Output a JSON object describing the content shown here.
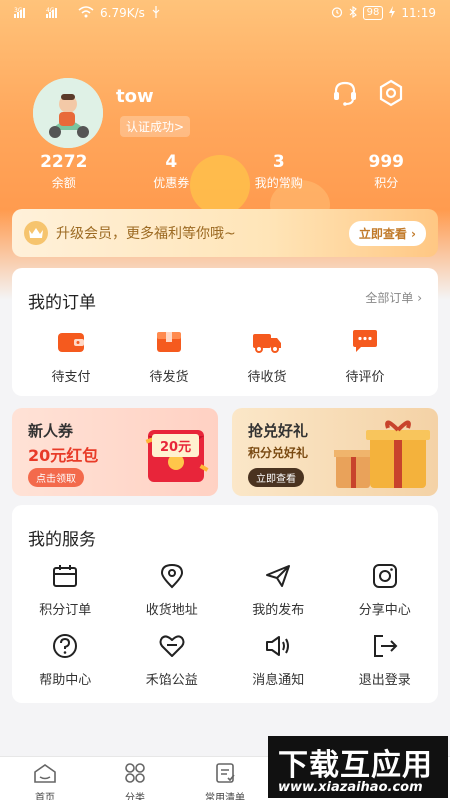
{
  "status_bar": {
    "speed": "6.79K/s",
    "battery": "98",
    "time": "11:19"
  },
  "profile": {
    "username": "tow",
    "verify_label": "认证成功>"
  },
  "stats": [
    {
      "value": "2272",
      "label": "余额"
    },
    {
      "value": "4",
      "label": "优惠券"
    },
    {
      "value": "3",
      "label": "我的常购"
    },
    {
      "value": "999",
      "label": "积分"
    }
  ],
  "vip_banner": {
    "text": "升级会员，更多福利等你哦~",
    "button": "立即查看 ›"
  },
  "orders": {
    "title": "我的订单",
    "all_link": "全部订单 ›",
    "items": [
      {
        "label": "待支付",
        "icon": "wallet-icon"
      },
      {
        "label": "待发货",
        "icon": "box-icon"
      },
      {
        "label": "待收货",
        "icon": "truck-icon"
      },
      {
        "label": "待评价",
        "icon": "comment-icon"
      }
    ]
  },
  "promos": [
    {
      "title": "新人券",
      "subtitle": "20元红包",
      "button": "点击领取",
      "badge": "20元"
    },
    {
      "title": "抢兑好礼",
      "subtitle": "积分兑好礼",
      "button": "立即查看"
    }
  ],
  "services": {
    "title": "我的服务",
    "items": [
      {
        "label": "积分订单",
        "icon": "calendar-icon"
      },
      {
        "label": "收货地址",
        "icon": "location-icon"
      },
      {
        "label": "我的发布",
        "icon": "send-icon"
      },
      {
        "label": "分享中心",
        "icon": "share-icon"
      },
      {
        "label": "帮助中心",
        "icon": "help-icon"
      },
      {
        "label": "禾馅公益",
        "icon": "heart-icon"
      },
      {
        "label": "消息通知",
        "icon": "speaker-icon"
      },
      {
        "label": "退出登录",
        "icon": "logout-icon"
      }
    ]
  },
  "tabs": [
    {
      "label": "首页",
      "icon": "home-icon"
    },
    {
      "label": "分类",
      "icon": "category-icon"
    },
    {
      "label": "常用清单",
      "icon": "list-icon"
    }
  ],
  "watermark": {
    "title": "下载互应用",
    "url": "www.xiazaihao.com"
  },
  "colors": {
    "accent": "#ff8c3b",
    "orange_icon": "#f55a1e"
  }
}
